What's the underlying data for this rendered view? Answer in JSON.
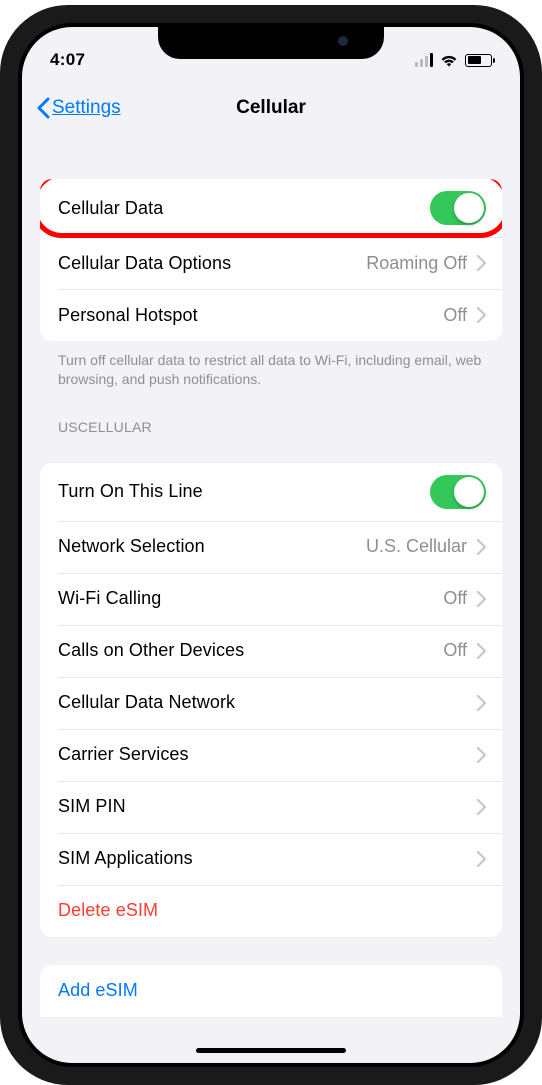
{
  "status": {
    "time": "4:07"
  },
  "nav": {
    "back": "Settings",
    "title": "Cellular"
  },
  "section1": {
    "cellular_data_label": "Cellular Data",
    "cellular_data_options_label": "Cellular Data Options",
    "cellular_data_options_value": "Roaming Off",
    "personal_hotspot_label": "Personal Hotspot",
    "personal_hotspot_value": "Off",
    "footer": "Turn off cellular data to restrict all data to Wi-Fi, including email, web browsing, and push notifications."
  },
  "section2": {
    "header": "USCELLULAR",
    "turn_on_line_label": "Turn On This Line",
    "network_selection_label": "Network Selection",
    "network_selection_value": "U.S. Cellular",
    "wifi_calling_label": "Wi-Fi Calling",
    "wifi_calling_value": "Off",
    "calls_other_devices_label": "Calls on Other Devices",
    "calls_other_devices_value": "Off",
    "cellular_data_network_label": "Cellular Data Network",
    "carrier_services_label": "Carrier Services",
    "sim_pin_label": "SIM PIN",
    "sim_applications_label": "SIM Applications",
    "delete_esim_label": "Delete eSIM"
  },
  "section3": {
    "add_esim_label": "Add eSIM"
  }
}
